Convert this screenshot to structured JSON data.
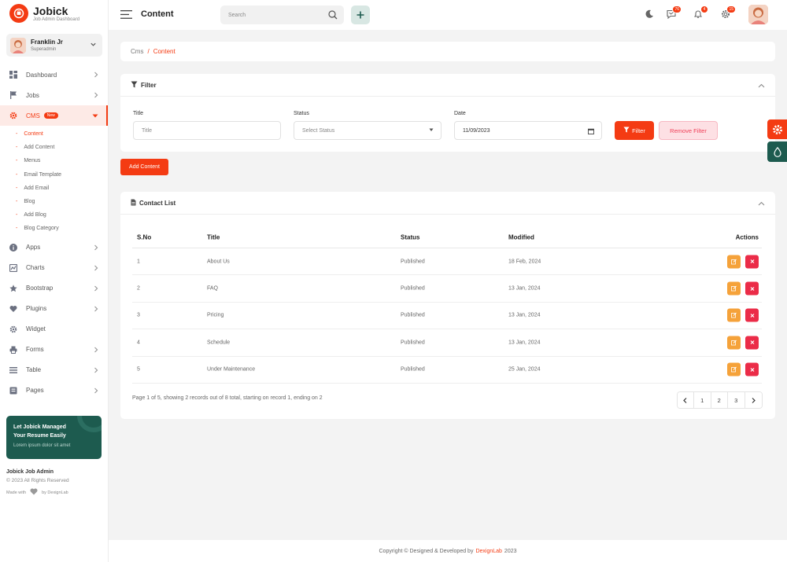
{
  "brand": {
    "title": "Jobick",
    "subtitle": "Job Admin Dashboard"
  },
  "user": {
    "name": "Franklin Jr",
    "role": "Superadmin"
  },
  "sidebar": {
    "items": [
      {
        "label": "Dashboard",
        "icon": "grid-icon"
      },
      {
        "label": "Jobs",
        "icon": "flag-icon"
      },
      {
        "label": "CMS",
        "icon": "gear-icon",
        "badge": "New"
      },
      {
        "label": "Apps",
        "icon": "info-icon"
      },
      {
        "label": "Charts",
        "icon": "chart-icon"
      },
      {
        "label": "Bootstrap",
        "icon": "star-icon"
      },
      {
        "label": "Plugins",
        "icon": "heart-icon"
      },
      {
        "label": "Widget",
        "icon": "gear-icon"
      },
      {
        "label": "Forms",
        "icon": "printer-icon"
      },
      {
        "label": "Table",
        "icon": "table-icon"
      },
      {
        "label": "Pages",
        "icon": "pages-icon"
      }
    ],
    "cms_sub": [
      "Content",
      "Add Content",
      "Menus",
      "Email Template",
      "Add Email",
      "Blog",
      "Add Blog",
      "Blog Category"
    ]
  },
  "promo": {
    "title_line1": "Let Jobick Managed",
    "title_line2": "Your Resume Easily",
    "text": "Lorem ipsum dolor sit amet"
  },
  "side_footer": {
    "title": "Jobick Job Admin",
    "copy": "© 2023 All Rights Reserved",
    "made_prefix": "Made with",
    "made_suffix": "by DexignLab"
  },
  "header": {
    "title": "Content",
    "search_placeholder": "Search",
    "notifications": {
      "messages": "76",
      "bell": "4",
      "settings": "15"
    }
  },
  "breadcrumb": {
    "parent": "Cms",
    "separator": "/",
    "current": "Content"
  },
  "filter": {
    "heading": "Filter",
    "title_label": "Title",
    "title_placeholder": "Title",
    "status_label": "Status",
    "status_value": "Select Status",
    "date_label": "Date",
    "date_value": "11/09/2023",
    "filter_button": "Filter",
    "remove_button": "Remove Filter"
  },
  "add_button": "Add Content",
  "contact_list": {
    "heading": "Contact List",
    "columns": [
      "S.No",
      "Title",
      "Status",
      "Modified",
      "Actions"
    ],
    "rows": [
      {
        "no": "1",
        "title": "About Us",
        "status": "Published",
        "modified": "18 Feb, 2024"
      },
      {
        "no": "2",
        "title": "FAQ",
        "status": "Published",
        "modified": "13 Jan, 2024"
      },
      {
        "no": "3",
        "title": "Pricing",
        "status": "Published",
        "modified": "13 Jan, 2024"
      },
      {
        "no": "4",
        "title": "Schedule",
        "status": "Published",
        "modified": "13 Jan, 2024"
      },
      {
        "no": "5",
        "title": "Under Maintenance",
        "status": "Published",
        "modified": "25 Jan, 2024"
      }
    ],
    "info": "Page 1 of 5, showing 2 records out of 8 total, starting on record 1, ending on 2",
    "pages": [
      "1",
      "2",
      "3"
    ]
  },
  "footer": {
    "prefix": "Copyright © Designed & Developed by",
    "brand": "DexignLab",
    "year": "2023"
  },
  "colors": {
    "accent": "#f43b13",
    "dark_green": "#1d5b4f",
    "edit": "#f5a23a",
    "delete": "#eb2c48"
  }
}
